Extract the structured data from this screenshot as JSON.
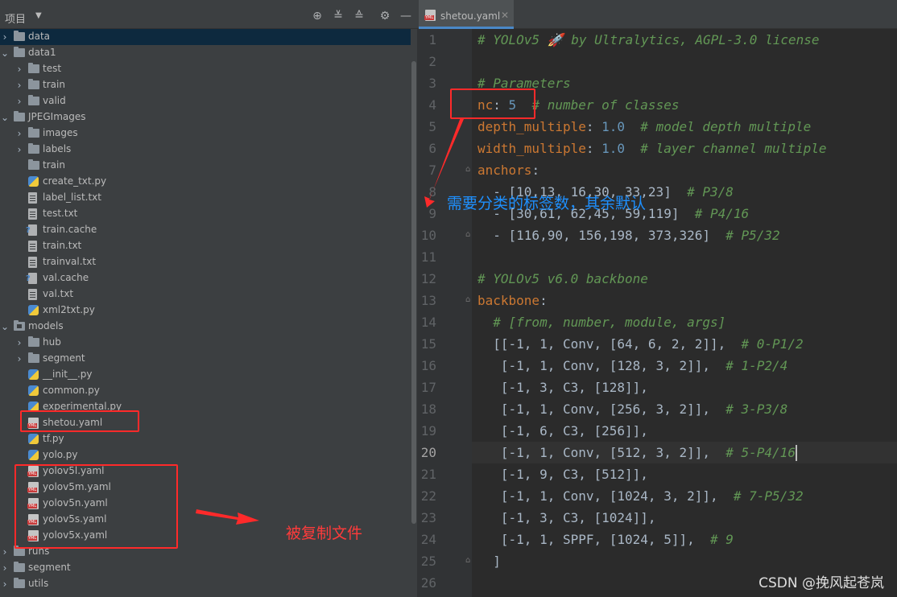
{
  "project_panel": {
    "title": "项目",
    "tree": [
      {
        "label": "data",
        "type": "folder",
        "depth": 0,
        "arrow": "right",
        "selected": true
      },
      {
        "label": "data1",
        "type": "folder",
        "depth": 0,
        "arrow": "down"
      },
      {
        "label": "test",
        "type": "folder",
        "depth": 1,
        "arrow": "right"
      },
      {
        "label": "train",
        "type": "folder",
        "depth": 1,
        "arrow": "right"
      },
      {
        "label": "valid",
        "type": "folder",
        "depth": 1,
        "arrow": "right"
      },
      {
        "label": "JPEGImages",
        "type": "folder",
        "depth": 0,
        "arrow": "down"
      },
      {
        "label": "images",
        "type": "folder",
        "depth": 1,
        "arrow": "right"
      },
      {
        "label": "labels",
        "type": "folder",
        "depth": 1,
        "arrow": "right"
      },
      {
        "label": "train",
        "type": "folder",
        "depth": 1,
        "arrow": ""
      },
      {
        "label": "create_txt.py",
        "type": "py",
        "depth": 1,
        "arrow": ""
      },
      {
        "label": "label_list.txt",
        "type": "file",
        "depth": 1,
        "arrow": ""
      },
      {
        "label": "test.txt",
        "type": "file",
        "depth": 1,
        "arrow": ""
      },
      {
        "label": "train.cache",
        "type": "cache",
        "depth": 1,
        "arrow": ""
      },
      {
        "label": "train.txt",
        "type": "file",
        "depth": 1,
        "arrow": ""
      },
      {
        "label": "trainval.txt",
        "type": "file",
        "depth": 1,
        "arrow": ""
      },
      {
        "label": "val.cache",
        "type": "cache",
        "depth": 1,
        "arrow": ""
      },
      {
        "label": "val.txt",
        "type": "file",
        "depth": 1,
        "arrow": ""
      },
      {
        "label": "xml2txt.py",
        "type": "py",
        "depth": 1,
        "arrow": ""
      },
      {
        "label": "models",
        "type": "folder-mod",
        "depth": 0,
        "arrow": "down"
      },
      {
        "label": "hub",
        "type": "folder",
        "depth": 1,
        "arrow": "right"
      },
      {
        "label": "segment",
        "type": "folder",
        "depth": 1,
        "arrow": "right"
      },
      {
        "label": "__init__.py",
        "type": "py",
        "depth": 1,
        "arrow": ""
      },
      {
        "label": "common.py",
        "type": "py",
        "depth": 1,
        "arrow": ""
      },
      {
        "label": "experimental.py",
        "type": "py",
        "depth": 1,
        "arrow": ""
      },
      {
        "label": "shetou.yaml",
        "type": "yml",
        "depth": 1,
        "arrow": ""
      },
      {
        "label": "tf.py",
        "type": "py",
        "depth": 1,
        "arrow": ""
      },
      {
        "label": "yolo.py",
        "type": "py",
        "depth": 1,
        "arrow": ""
      },
      {
        "label": "yolov5l.yaml",
        "type": "yml",
        "depth": 1,
        "arrow": ""
      },
      {
        "label": "yolov5m.yaml",
        "type": "yml",
        "depth": 1,
        "arrow": ""
      },
      {
        "label": "yolov5n.yaml",
        "type": "yml",
        "depth": 1,
        "arrow": ""
      },
      {
        "label": "yolov5s.yaml",
        "type": "yml",
        "depth": 1,
        "arrow": ""
      },
      {
        "label": "yolov5x.yaml",
        "type": "yml",
        "depth": 1,
        "arrow": ""
      },
      {
        "label": "runs",
        "type": "folder",
        "depth": 0,
        "arrow": "right"
      },
      {
        "label": "segment",
        "type": "folder",
        "depth": 0,
        "arrow": "right"
      },
      {
        "label": "utils",
        "type": "folder",
        "depth": 0,
        "arrow": "right"
      }
    ]
  },
  "editor": {
    "tab_label": "shetou.yaml",
    "current_line": 20,
    "lines": [
      {
        "n": "1",
        "tokens": [
          [
            "cm",
            "# YOLOv5 🚀 by Ultralytics, AGPL-3.0 license"
          ]
        ]
      },
      {
        "n": "2",
        "tokens": []
      },
      {
        "n": "3",
        "tokens": [
          [
            "cm",
            "# Parameters"
          ]
        ]
      },
      {
        "n": "4",
        "tokens": [
          [
            "ky",
            "nc"
          ],
          [
            "tx",
            ": "
          ],
          [
            "nm",
            "5"
          ],
          [
            "tx",
            "  "
          ],
          [
            "cm",
            "# number of classes"
          ]
        ]
      },
      {
        "n": "5",
        "tokens": [
          [
            "ky",
            "depth_multiple"
          ],
          [
            "tx",
            ": "
          ],
          [
            "nm",
            "1.0"
          ],
          [
            "tx",
            "  "
          ],
          [
            "cm",
            "# model depth multiple"
          ]
        ]
      },
      {
        "n": "6",
        "tokens": [
          [
            "ky",
            "width_multiple"
          ],
          [
            "tx",
            ": "
          ],
          [
            "nm",
            "1.0"
          ],
          [
            "tx",
            "  "
          ],
          [
            "cm",
            "# layer channel multiple"
          ]
        ]
      },
      {
        "n": "7",
        "tokens": [
          [
            "ky",
            "anchors"
          ],
          [
            "tx",
            ":"
          ]
        ]
      },
      {
        "n": "8",
        "tokens": [
          [
            "tx",
            "  - [10,13, 16,30, 33,23]  "
          ],
          [
            "cm",
            "# P3/8"
          ]
        ]
      },
      {
        "n": "9",
        "tokens": [
          [
            "tx",
            "  - [30,61, 62,45, 59,119]  "
          ],
          [
            "cm",
            "# P4/16"
          ]
        ]
      },
      {
        "n": "10",
        "tokens": [
          [
            "tx",
            "  - [116,90, 156,198, 373,326]  "
          ],
          [
            "cm",
            "# P5/32"
          ]
        ]
      },
      {
        "n": "11",
        "tokens": []
      },
      {
        "n": "12",
        "tokens": [
          [
            "cm",
            "# YOLOv5 v6.0 backbone"
          ]
        ]
      },
      {
        "n": "13",
        "tokens": [
          [
            "ky",
            "backbone"
          ],
          [
            "tx",
            ":"
          ]
        ]
      },
      {
        "n": "14",
        "tokens": [
          [
            "tx",
            "  "
          ],
          [
            "cm",
            "# [from, number, module, args]"
          ]
        ]
      },
      {
        "n": "15",
        "tokens": [
          [
            "tx",
            "  [[-1, 1, Conv, [64, 6, 2, 2]],  "
          ],
          [
            "cm",
            "# 0-P1/2"
          ]
        ]
      },
      {
        "n": "16",
        "tokens": [
          [
            "tx",
            "   [-1, 1, Conv, [128, 3, 2]],  "
          ],
          [
            "cm",
            "# 1-P2/4"
          ]
        ]
      },
      {
        "n": "17",
        "tokens": [
          [
            "tx",
            "   [-1, 3, C3, [128]],"
          ]
        ]
      },
      {
        "n": "18",
        "tokens": [
          [
            "tx",
            "   [-1, 1, Conv, [256, 3, 2]],  "
          ],
          [
            "cm",
            "# 3-P3/8"
          ]
        ]
      },
      {
        "n": "19",
        "tokens": [
          [
            "tx",
            "   [-1, 6, C3, [256]],"
          ]
        ]
      },
      {
        "n": "20",
        "tokens": [
          [
            "tx",
            "   [-1, 1, Conv, [512, 3, 2]],  "
          ],
          [
            "cm",
            "# 5-P4/16"
          ]
        ]
      },
      {
        "n": "21",
        "tokens": [
          [
            "tx",
            "   [-1, 9, C3, [512]],"
          ]
        ]
      },
      {
        "n": "22",
        "tokens": [
          [
            "tx",
            "   [-1, 1, Conv, [1024, 3, 2]],  "
          ],
          [
            "cm",
            "# 7-P5/32"
          ]
        ]
      },
      {
        "n": "23",
        "tokens": [
          [
            "tx",
            "   [-1, 3, C3, [1024]],"
          ]
        ]
      },
      {
        "n": "24",
        "tokens": [
          [
            "tx",
            "   [-1, 1, SPPF, [1024, 5]],  "
          ],
          [
            "cm",
            "# 9"
          ]
        ]
      },
      {
        "n": "25",
        "tokens": [
          [
            "tx",
            "  ]"
          ]
        ]
      },
      {
        "n": "26",
        "tokens": []
      }
    ]
  },
  "annotations": {
    "nc_note": "需要分类的标签数，其余默认",
    "copied_note": "被复制文件"
  },
  "watermark": "CSDN @挽风起苍岚",
  "colors": {
    "accent": "#4a88c7",
    "annotation_red": "#ff2a2a",
    "annotation_blue": "#1e90ff"
  },
  "icons": {
    "toolbar": [
      "locate-icon",
      "expand-all-icon",
      "collapse-all-icon",
      "gear-icon",
      "minimize-icon"
    ]
  }
}
